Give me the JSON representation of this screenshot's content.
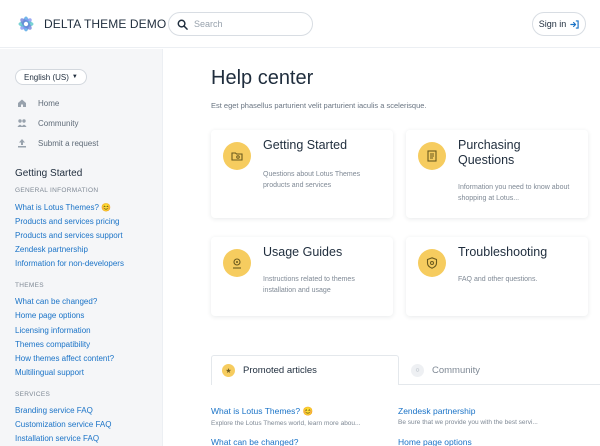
{
  "header": {
    "brand": "DELTA THEME DEMO",
    "search_placeholder": "Search",
    "signin_label": "Sign in"
  },
  "sidebar": {
    "language": "English (US)",
    "nav": [
      {
        "label": "Home",
        "icon": "home-icon"
      },
      {
        "label": "Community",
        "icon": "community-icon"
      },
      {
        "label": "Submit a request",
        "icon": "submit-request-icon"
      }
    ],
    "section_title": "Getting Started",
    "groups": [
      {
        "title": "GENERAL INFORMATION",
        "links": [
          "What is Lotus Themes? 😊",
          "Products and services pricing",
          "Products and services support",
          "Zendesk partnership",
          "Information for non-developers"
        ]
      },
      {
        "title": "THEMES",
        "links": [
          "What can be changed?",
          "Home page options",
          "Licensing information",
          "Themes compatibility",
          "How themes affect content?",
          "Multilingual support"
        ]
      },
      {
        "title": "SERVICES",
        "links": [
          "Branding service FAQ",
          "Customization service FAQ",
          "Installation service FAQ"
        ]
      }
    ]
  },
  "main": {
    "title": "Help center",
    "description": "Est eget phasellus parturient velit parturient iaculis a scelerisque.",
    "cards": [
      {
        "title": "Getting Started",
        "description": "Questions about Lotus Themes products and services",
        "icon": "folder-icon"
      },
      {
        "title": "Purchasing Questions",
        "description": "Information you need to know about shopping at Lotus...",
        "icon": "receipt-icon"
      },
      {
        "title": "Usage Guides",
        "description": "Instructions related to themes installation and usage",
        "icon": "guide-icon"
      },
      {
        "title": "Troubleshooting",
        "description": "FAQ and other questions.",
        "icon": "shield-icon"
      }
    ],
    "tabs": [
      {
        "label": "Promoted articles",
        "icon": "star-icon"
      },
      {
        "label": "Community",
        "icon": "community-tab-icon"
      }
    ],
    "articles": [
      {
        "title": "What is Lotus Themes? 😊",
        "description": "Explore the Lotus Themes world, learn more abou..."
      },
      {
        "title": "Zendesk partnership",
        "description": "Be sure that we provide you with the best servi..."
      },
      {
        "title": "What can be changed?",
        "description": ""
      },
      {
        "title": "Home page options",
        "description": ""
      }
    ]
  },
  "colors": {
    "accent_yellow": "#f6cc5f",
    "link_blue": "#1a73c7",
    "sidebar_bg": "#f5f6f8"
  }
}
